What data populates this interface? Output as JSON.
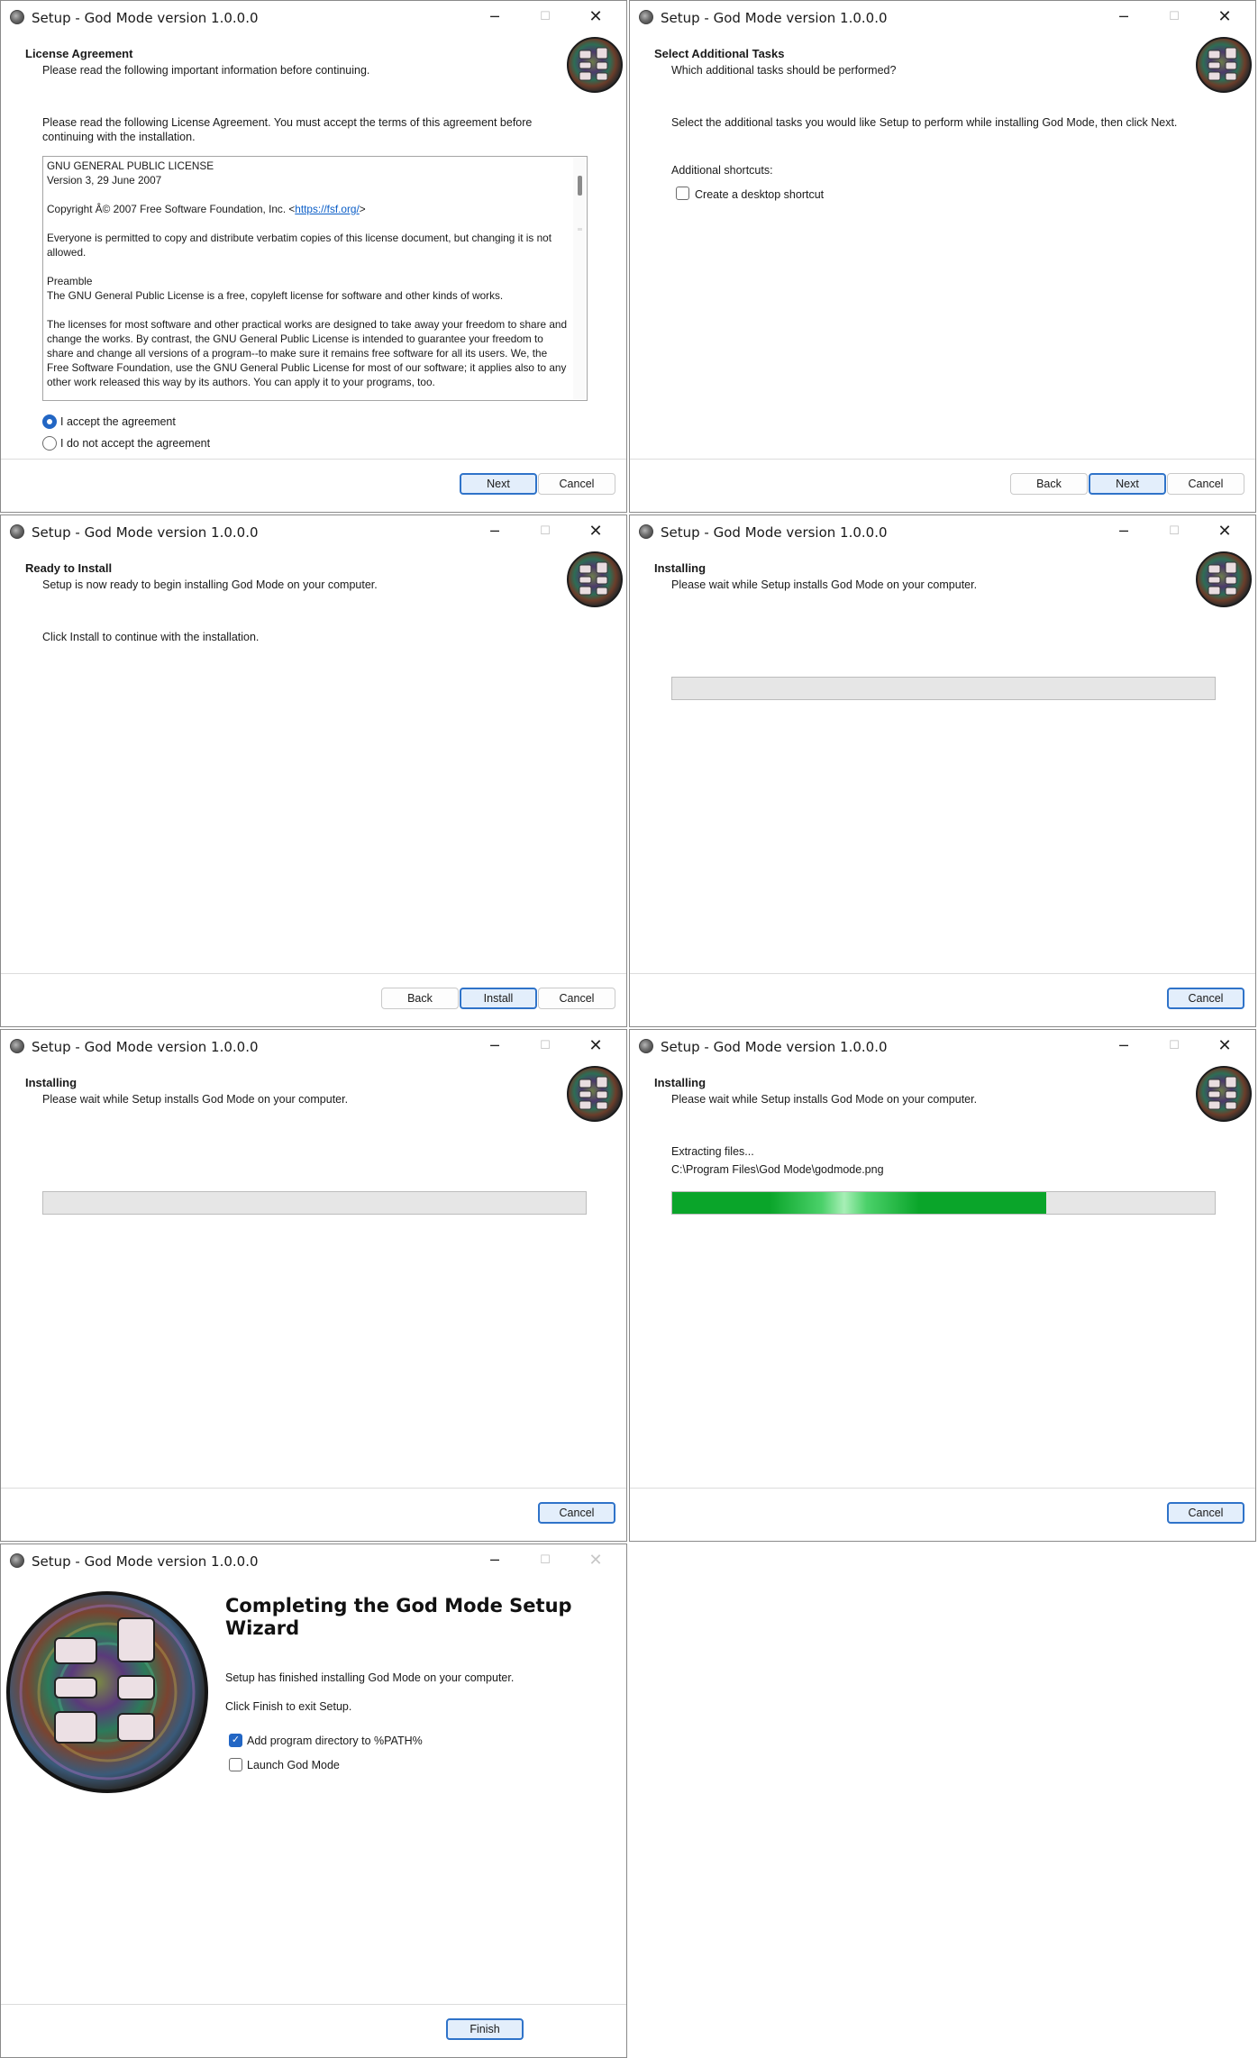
{
  "window_title": "Setup - God Mode version 1.0.0.0",
  "buttons": {
    "next": "Next",
    "back": "Back",
    "cancel": "Cancel",
    "install": "Install",
    "finish": "Finish"
  },
  "window_controls": {
    "minimize": "─",
    "maximize": "☐",
    "close": "✕"
  },
  "license": {
    "title": "License Agreement",
    "subtitle": "Please read the following important information before continuing.",
    "intro": "Please read the following License Agreement. You must accept the terms of this agreement before continuing with the installation.",
    "text_lines": [
      "GNU GENERAL PUBLIC LICENSE",
      "Version 3, 29 June 2007",
      "",
      "Copyright Â© 2007 Free Software Foundation, Inc. <",
      "https://fsf.org/",
      ">",
      "",
      "Everyone is permitted to copy and distribute verbatim copies of this license document, but changing it is not allowed.",
      "",
      "Preamble",
      "The GNU General Public License is a free, copyleft license for software and other kinds of works.",
      "",
      "The licenses for most software and other practical works are designed to take away your freedom to share and change the works. By contrast, the GNU General Public License is intended to guarantee your freedom to share and change all versions of a program--to make sure it remains free software for all its users. We, the Free Software Foundation, use the GNU General Public License for most of our software; it applies also to any other work released this way by its authors. You can apply it to your programs, too."
    ],
    "accept_label": "I accept the agreement",
    "decline_label": "I do not accept the agreement",
    "accept_selected": true
  },
  "tasks": {
    "title": "Select Additional Tasks",
    "subtitle": "Which additional tasks should be performed?",
    "intro": "Select the additional tasks you would like Setup to perform while installing God Mode, then click Next.",
    "group_label": "Additional shortcuts:",
    "desktop_shortcut_label": "Create a desktop shortcut",
    "desktop_shortcut_checked": false
  },
  "ready": {
    "title": "Ready to Install",
    "subtitle": "Setup is now ready to begin installing God Mode on your computer.",
    "instruction": "Click Install to continue with the installation."
  },
  "installing": {
    "title": "Installing",
    "subtitle": "Please wait while Setup installs God Mode on your computer.",
    "status": "Extracting files...",
    "current_file": "C:\\Program Files\\God Mode\\godmode.png",
    "progress_early": 0,
    "progress_late": 0.69
  },
  "finish": {
    "title": "Completing the God Mode Setup Wizard",
    "line1": "Setup has finished installing God Mode on your computer.",
    "line2": "Click Finish to exit Setup.",
    "add_path_label": "Add program directory to %PATH%",
    "add_path_checked": true,
    "launch_label": "Launch God Mode",
    "launch_checked": false
  },
  "colors": {
    "accent": "#2266c4",
    "progress_green": "#0aa52a"
  }
}
